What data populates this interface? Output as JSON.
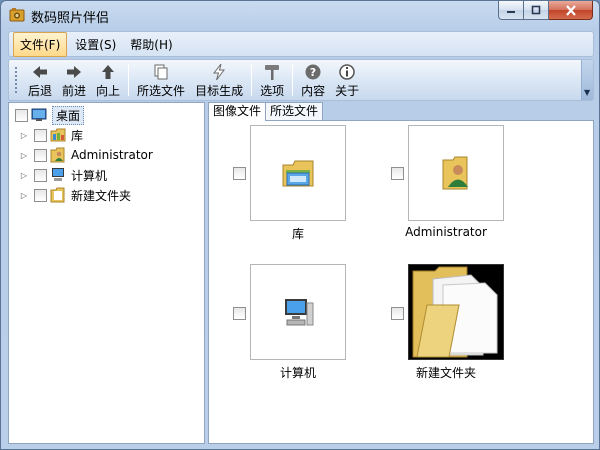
{
  "window": {
    "title": "数码照片伴侣"
  },
  "menu": {
    "items": [
      {
        "label": "文件(F)"
      },
      {
        "label": "设置(S)"
      },
      {
        "label": "帮助(H)"
      }
    ]
  },
  "toolbar": {
    "back": "后退",
    "forward": "前进",
    "up": "向上",
    "selected_files": "所选文件",
    "target_generate": "目标生成",
    "options": "选项",
    "content": "内容",
    "about": "关于"
  },
  "tree": {
    "root": "桌面",
    "items": [
      {
        "label": "库",
        "icon": "library-icon"
      },
      {
        "label": "Administrator",
        "icon": "user-folder-icon"
      },
      {
        "label": "计算机",
        "icon": "computer-icon"
      },
      {
        "label": "新建文件夹",
        "icon": "folder-icon"
      }
    ]
  },
  "tabs": [
    {
      "label": "图像文件"
    },
    {
      "label": "所选文件"
    }
  ],
  "tiles": [
    {
      "label": "库",
      "icon": "library-icon"
    },
    {
      "label": "Administrator",
      "icon": "user-folder-icon"
    },
    {
      "label": "计算机",
      "icon": "computer-icon"
    },
    {
      "label": "新建文件夹",
      "icon": "folder-icon"
    }
  ],
  "colors": {
    "window_frame": "#b9cfe9",
    "menu_active": "#ffd98a",
    "close_button": "#c1442a"
  }
}
